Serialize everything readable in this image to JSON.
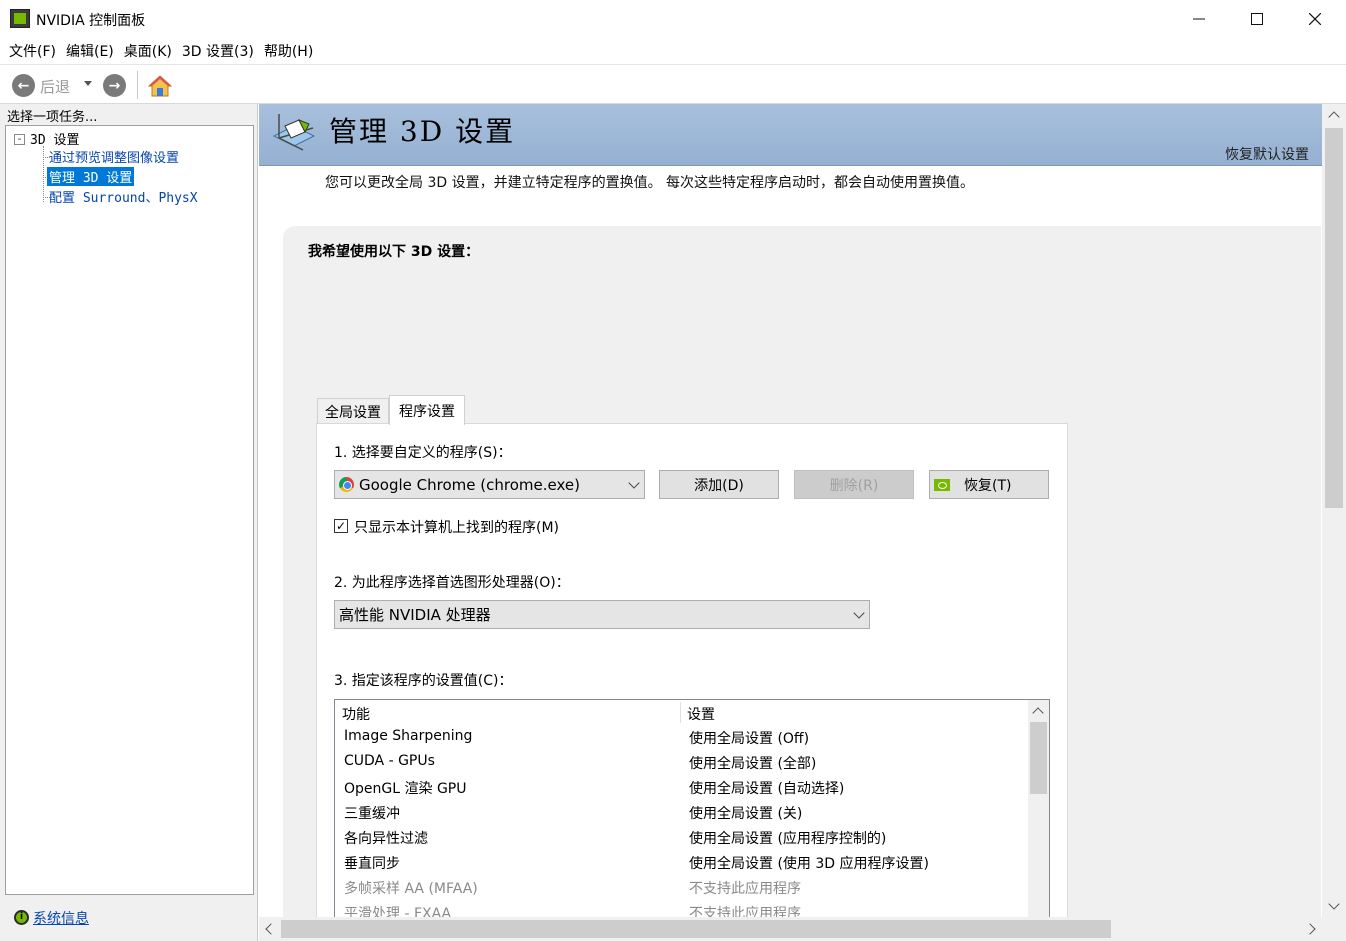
{
  "window": {
    "title": "NVIDIA 控制面板"
  },
  "menu": [
    {
      "label": "文件(F)"
    },
    {
      "label": "编辑(E)"
    },
    {
      "label": "桌面(K)"
    },
    {
      "label": "3D 设置(3)"
    },
    {
      "label": "帮助(H)"
    }
  ],
  "toolbar": {
    "back_label": "后退"
  },
  "sidebar": {
    "caption": "选择一项任务...",
    "root": "3D 设置",
    "items": [
      {
        "label": "通过预览调整图像设置",
        "selected": false
      },
      {
        "label": "管理 3D 设置",
        "selected": true
      },
      {
        "label": "配置 Surround、PhysX",
        "selected": false
      }
    ],
    "system_info": "系统信息"
  },
  "page": {
    "title": "管理 3D 设置",
    "restore_defaults": "恢复默认设置",
    "description": "您可以更改全局 3D 设置，并建立特定程序的置换值。 每次这些特定程序启动时，都会自动使用置换值。",
    "heading": "我希望使用以下 3D 设置：",
    "tabs": [
      {
        "label": "全局设置",
        "active": false
      },
      {
        "label": "程序设置",
        "active": true
      }
    ],
    "step1": {
      "label": "1. 选择要自定义的程序(S)：",
      "program": "Google Chrome (chrome.exe)",
      "add": "添加(D)",
      "remove": "删除(R)",
      "restore": "恢复(T)",
      "show_only_found": "只显示本计算机上找到的程序(M)",
      "show_only_checked": true
    },
    "step2": {
      "label": "2. 为此程序选择首选图形处理器(O)：",
      "processor": "高性能 NVIDIA 处理器"
    },
    "step3": {
      "label": "3. 指定该程序的设置值(C)：",
      "columns": [
        "功能",
        "设置"
      ],
      "rows": [
        {
          "feature": "Image Sharpening",
          "setting": "使用全局设置 (Off)",
          "supported": true
        },
        {
          "feature": "CUDA - GPUs",
          "setting": "使用全局设置 (全部)",
          "supported": true
        },
        {
          "feature": "OpenGL 渲染 GPU",
          "setting": "使用全局设置 (自动选择)",
          "supported": true
        },
        {
          "feature": "三重缓冲",
          "setting": "使用全局设置 (关)",
          "supported": true
        },
        {
          "feature": "各向异性过滤",
          "setting": "使用全局设置 (应用程序控制的)",
          "supported": true
        },
        {
          "feature": "垂直同步",
          "setting": "使用全局设置 (使用 3D 应用程序设置)",
          "supported": true
        },
        {
          "feature": "多帧采样 AA (MFAA)",
          "setting": "不支持此应用程序",
          "supported": false
        },
        {
          "feature": "平滑处理 - FXAA",
          "setting": "不支持此应用程序",
          "supported": false
        }
      ]
    }
  },
  "colors": {
    "accent": "#76b900",
    "selection": "#0078d7",
    "link": "#0645ad",
    "banner": "#a8c0dc"
  }
}
